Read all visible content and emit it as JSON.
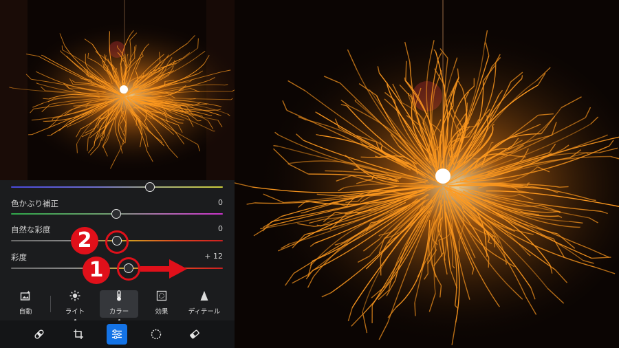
{
  "sliders": [
    {
      "label": "",
      "value": ""
    },
    {
      "label": "色かぶり補正",
      "value": "0"
    },
    {
      "label": "自然な彩度",
      "value": "0"
    },
    {
      "label": "彩度",
      "value": "+ 12"
    }
  ],
  "slider_levels": [
    0.66,
    0.5,
    0.5,
    0.55
  ],
  "annotations": {
    "badge_1": "1",
    "badge_2": "2"
  },
  "tabs": [
    {
      "label": "自動",
      "icon": "auto-image-icon"
    },
    {
      "label": "ライト",
      "icon": "sun-icon"
    },
    {
      "label": "カラー",
      "icon": "thermometer-icon",
      "active": true
    },
    {
      "label": "効果",
      "icon": "effects-frame-icon"
    },
    {
      "label": "ディテール",
      "icon": "detail-triangle-icon"
    }
  ],
  "toolbar": [
    {
      "name": "heal-bandage-icon"
    },
    {
      "name": "crop-rotate-icon"
    },
    {
      "name": "sliders-icon",
      "active": true
    },
    {
      "name": "selective-circle-icon"
    },
    {
      "name": "eraser-icon"
    }
  ],
  "colors": {
    "accent": "#1473e6",
    "annotation_red": "#e0101a",
    "panel_bg": "#1b1c1e",
    "spark_orange": "#ff9a1f"
  }
}
